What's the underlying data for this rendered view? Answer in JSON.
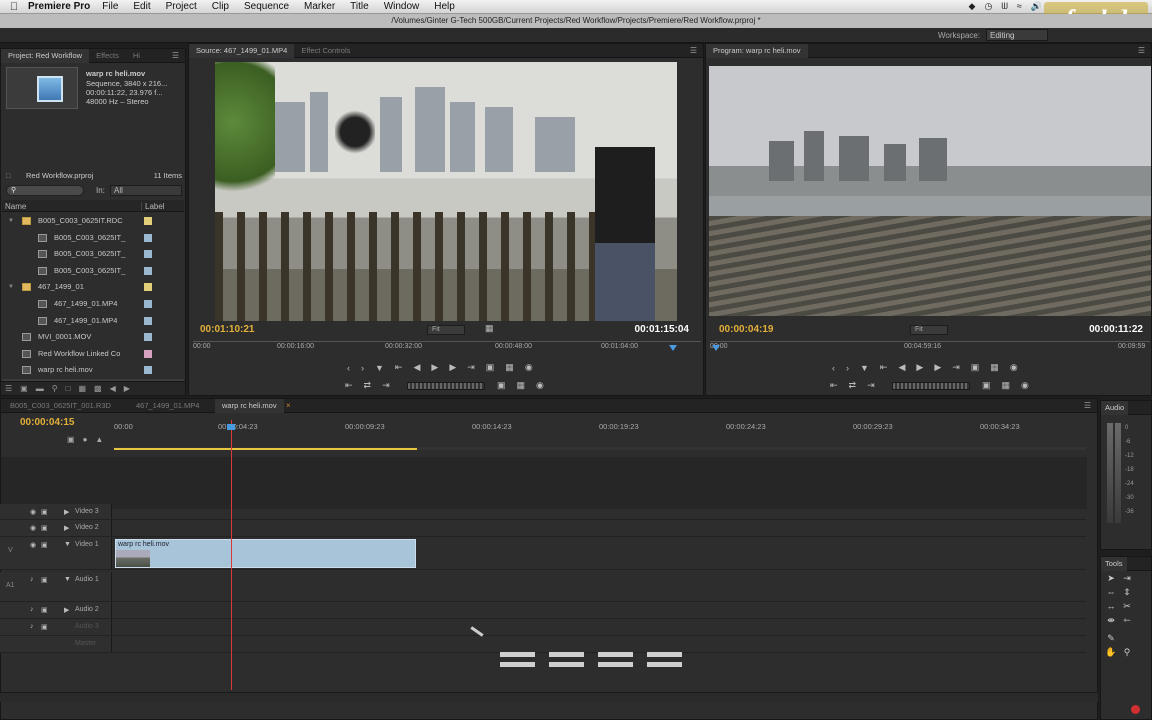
{
  "menubar": {
    "app": "Premiere Pro",
    "items": [
      "File",
      "Edit",
      "Project",
      "Clip",
      "Sequence",
      "Marker",
      "Title",
      "Window",
      "Help"
    ]
  },
  "titlebar": {
    "path": "/Volumes/Ginter G-Tech 500GB/Current Projects/Red Workflow/Projects/Premiere/Red Workflow.prproj *"
  },
  "logo": {
    "text": "fxphd"
  },
  "workspace": {
    "label": "Workspace:",
    "value": "Editing"
  },
  "project": {
    "tabs": [
      "Project: Red Workflow",
      "Effects",
      "Hi"
    ],
    "clip_name": "warp rc heli.mov",
    "clip_info": [
      "Sequence, 3840 x 216...",
      "00:00:11:22, 23.976 f...",
      "48000 Hz – Stereo"
    ],
    "bin": "Red Workflow.prproj",
    "count": "11 Items",
    "search_placeholder": "",
    "in_label": "In:",
    "in_value": "All",
    "col_name": "Name",
    "col_label": "Label",
    "items": [
      {
        "name": "B005_C003_0625IT.RDC",
        "type": "folder",
        "expand": "▼",
        "indent": 0,
        "label": "#e3cf7a"
      },
      {
        "name": "B005_C003_0625IT_",
        "type": "file",
        "expand": "",
        "indent": 1,
        "label": "#9ab8d0"
      },
      {
        "name": "B005_C003_0625IT_",
        "type": "file",
        "expand": "",
        "indent": 1,
        "label": "#9ab8d0"
      },
      {
        "name": "B005_C003_0625IT_",
        "type": "seq",
        "expand": "",
        "indent": 1,
        "label": "#9ab8d0"
      },
      {
        "name": "467_1499_01",
        "type": "folder",
        "expand": "▼",
        "indent": 0,
        "label": "#e3cf7a"
      },
      {
        "name": "467_1499_01.MP4",
        "type": "file",
        "expand": "",
        "indent": 1,
        "label": "#9ab8d0"
      },
      {
        "name": "467_1499_01.MP4",
        "type": "seq",
        "expand": "",
        "indent": 1,
        "label": "#9ab8d0"
      },
      {
        "name": "MVI_0001.MOV",
        "type": "file",
        "expand": "",
        "indent": 0,
        "label": "#9ab8d0"
      },
      {
        "name": "Red Workflow Linked Co",
        "type": "seq",
        "expand": "",
        "indent": 0,
        "label": "#d6a2c0"
      },
      {
        "name": "warp rc heli.mov",
        "type": "file",
        "expand": "",
        "indent": 0,
        "label": "#9ab8d0"
      },
      {
        "name": "warp rc heli.mov",
        "type": "seq",
        "expand": "",
        "indent": 0,
        "label": "#9ab8d0"
      }
    ]
  },
  "source": {
    "tabs": [
      "Source: 467_1499_01.MP4",
      "Effect Controls"
    ],
    "timecode": "00:01:10:21",
    "fit": "Fit",
    "duration": "00:01:15:04",
    "ruler": [
      "00:00",
      "00:00:16:00",
      "00:00:32:00",
      "00:00:48:00",
      "00:01:04:00"
    ]
  },
  "program": {
    "tabs": [
      "Program: warp rc heli.mov"
    ],
    "timecode": "00:00:04:19",
    "fit": "Fit",
    "duration": "00:00:11:22",
    "ruler": [
      "00:00",
      "00:04:59:16",
      "00:09:59"
    ]
  },
  "timeline": {
    "tabs": [
      "B005_C003_0625IT_001.R3D",
      "467_1499_01.MP4",
      "warp rc heli.mov"
    ],
    "timecode": "00:00:04:15",
    "ruler": [
      "00:00",
      "00:00:04:23",
      "00:00:09:23",
      "00:00:14:23",
      "00:00:19:23",
      "00:00:24:23",
      "00:00:29:23",
      "00:00:34:23"
    ],
    "tracks": [
      "Video 3",
      "Video 2",
      "Video 1",
      "Audio 1",
      "Audio 2",
      "Audio 3",
      "Master"
    ],
    "track_side": [
      "V",
      "A1"
    ],
    "clip_label": "warp rc heli.mov"
  },
  "audio_meter": {
    "title": "Audio",
    "scale": [
      "0",
      "-6",
      "-12",
      "-18",
      "-24",
      "-30",
      "-36"
    ]
  },
  "tools": {
    "title": "Tools"
  }
}
